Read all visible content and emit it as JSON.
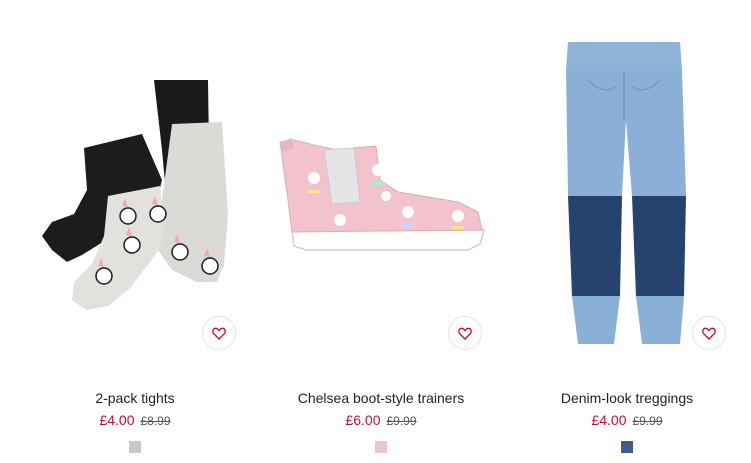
{
  "products": [
    {
      "title": "2-pack tights",
      "price": "£4.00",
      "old_price": "£8.99",
      "swatch_color": "#c8c8c8",
      "image_icon": "tights-image"
    },
    {
      "title": "Chelsea boot-style trainers",
      "price": "£6.00",
      "old_price": "£9.99",
      "swatch_color": "#e6c6d3",
      "image_icon": "trainer-image"
    },
    {
      "title": "Denim-look treggings",
      "price": "£4.00",
      "old_price": "£9.99",
      "swatch_color": "#3f5a8c",
      "image_icon": "treggings-image"
    }
  ],
  "favorite_icon": "heart-icon",
  "accent_color": "#c8102e"
}
